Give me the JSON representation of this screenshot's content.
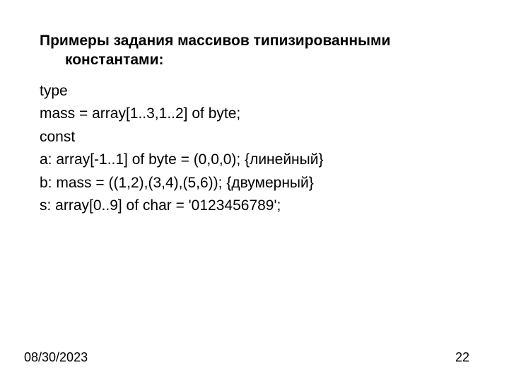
{
  "heading": {
    "line1": "Примеры задания массивов типизированными",
    "line2": "константами:"
  },
  "code": {
    "l1": "type",
    "l2": "mass = array[1..3,1..2] of byte;",
    "l3": "const",
    "l4": "a: array[-1..1] of byte = (0,0,0); {линейный}",
    "l5": "b: mass = ((1,2),(3,4),(5,6)); {двумерный}",
    "l6": "s: array[0..9] of char = '0123456789';"
  },
  "footer": {
    "date": "08/30/2023",
    "page": "22"
  }
}
